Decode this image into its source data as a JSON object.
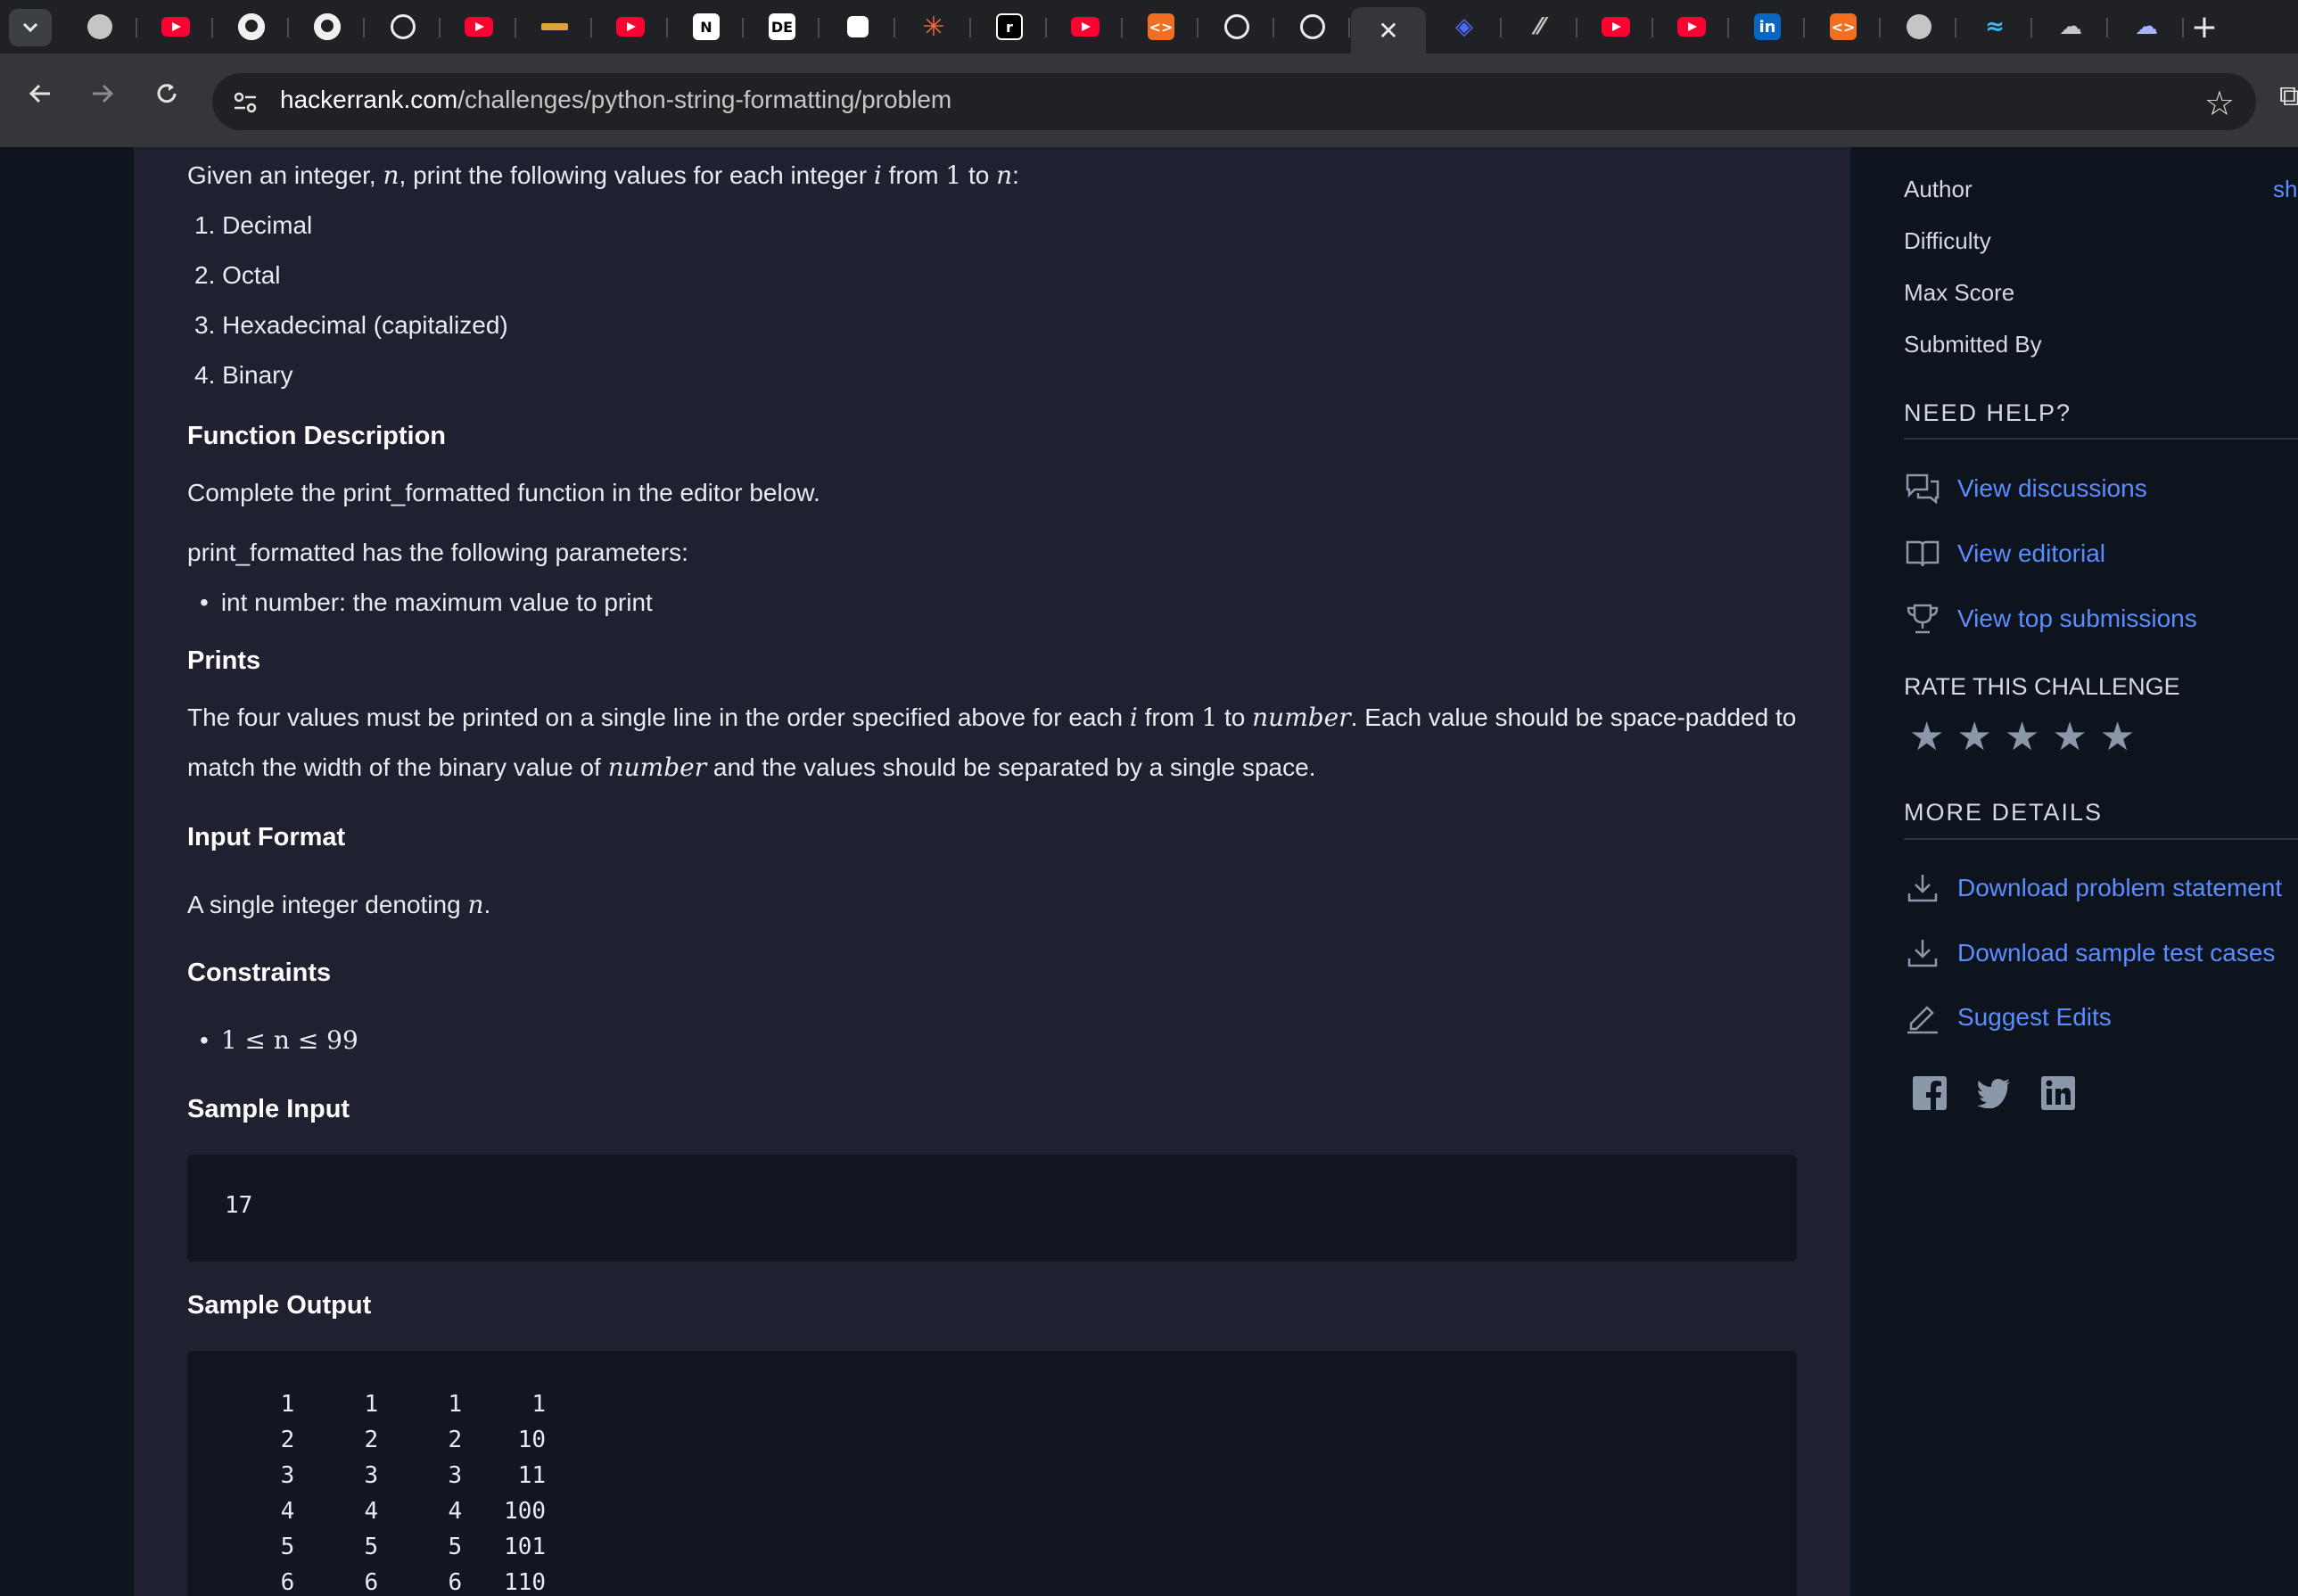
{
  "browser": {
    "tabs": [
      {
        "icon": "globe-icon"
      },
      {
        "icon": "youtube-icon"
      },
      {
        "icon": "github-icon"
      },
      {
        "icon": "github-icon"
      },
      {
        "icon": "openai-icon"
      },
      {
        "icon": "youtube-icon"
      },
      {
        "icon": "college-icon"
      },
      {
        "icon": "youtube-icon"
      },
      {
        "icon": "notion-icon"
      },
      {
        "icon": "de-icon"
      },
      {
        "icon": "box-icon"
      },
      {
        "icon": "claude-icon"
      },
      {
        "icon": "replit-icon"
      },
      {
        "icon": "youtube-icon"
      },
      {
        "icon": "codechef-icon"
      },
      {
        "icon": "openai-icon"
      },
      {
        "icon": "openai-icon"
      },
      {
        "icon": "close-icon"
      },
      {
        "icon": "deepseek-icon"
      },
      {
        "icon": "slash-icon"
      },
      {
        "icon": "youtube-icon"
      },
      {
        "icon": "youtube-icon"
      },
      {
        "icon": "linkedin-icon"
      },
      {
        "icon": "codechef-icon"
      },
      {
        "icon": "globe-icon"
      },
      {
        "icon": "tailwind-icon"
      },
      {
        "icon": "cloud-icon"
      },
      {
        "icon": "cloud-icon"
      }
    ],
    "url_host": "hackerrank.com",
    "url_path": "/challenges/python-string-formatting/problem",
    "accent": "#5b8dff"
  },
  "problem": {
    "intro_pre": "Given an integer, ",
    "intro_n": "n",
    "intro_mid": ", print the following values for each integer ",
    "intro_i": "i",
    "intro_from": " from ",
    "intro_1": "1",
    "intro_to": " to ",
    "intro_n2": "n",
    "intro_colon": ":",
    "list": [
      "1. Decimal",
      "2. Octal",
      "3. Hexadecimal (capitalized)",
      "4. Binary"
    ],
    "func_heading": "Function Description",
    "func_text": "Complete the print_formatted function in the editor below.",
    "params_text": "print_formatted has the following parameters:",
    "param_item": "int number: the maximum value to print",
    "prints_heading": "Prints",
    "prints_a": "The four values must be printed on a single line in the order specified above for each ",
    "prints_i": "i",
    "prints_from": " from ",
    "prints_1": "1",
    "prints_to": " to ",
    "prints_number": "number",
    "prints_b": ". Each value should be space-padded to match the width of the binary value of ",
    "prints_number2": "number",
    "prints_c": " and the values should be separated by a single space.",
    "input_heading": "Input Format",
    "input_pre": "A single integer denoting ",
    "input_n": "n",
    "input_post": ".",
    "constraints_heading": "Constraints",
    "constraint": "1 ≤ n ≤ 99",
    "sample_input_heading": "Sample Input",
    "sample_input": "17",
    "sample_output_heading": "Sample Output",
    "sample_output": "    1     1     1     1\n    2     2     2    10\n    3     3     3    11\n    4     4     4   100\n    5     5     5   101\n    6     6     6   110"
  },
  "sidebar": {
    "author_label": "Author",
    "author_value": "sh",
    "difficulty_label": "Difficulty",
    "max_score_label": "Max Score",
    "submitted_label": "Submitted By",
    "need_help": "NEED HELP?",
    "help_links": [
      "View discussions",
      "View editorial",
      "View top submissions"
    ],
    "rate_title": "RATE THIS CHALLENGE",
    "rating_stars": 5,
    "more_details": "MORE DETAILS",
    "detail_links": [
      "Download problem statement",
      "Download sample test cases",
      "Suggest Edits"
    ],
    "social": [
      "facebook-icon",
      "twitter-icon",
      "linkedin-icon"
    ]
  }
}
